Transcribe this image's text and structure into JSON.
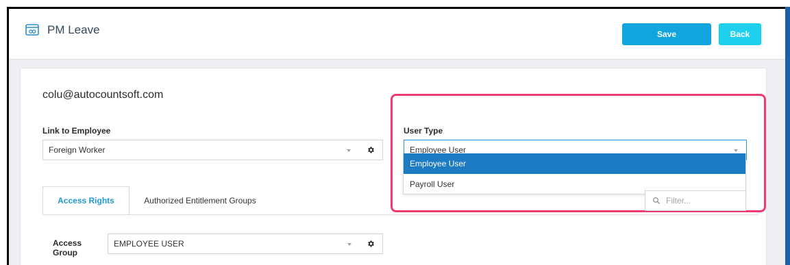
{
  "app": {
    "title": "PM Leave"
  },
  "toolbar": {
    "save_label": "Save",
    "back_label": "Back"
  },
  "account": {
    "email": "colu@autocountsoft.com"
  },
  "link_employee": {
    "label": "Link to Employee",
    "value": "Foreign Worker"
  },
  "user_type": {
    "label": "User Type",
    "value": "Employee User",
    "options": [
      "Employee User",
      "Payroll User"
    ],
    "selected_index": 0
  },
  "tabs": [
    {
      "label": "Access Rights",
      "active": true
    },
    {
      "label": "Authorized Entitlement Groups",
      "active": false
    }
  ],
  "access_group": {
    "label_line1": "Access",
    "label_line2": "Group",
    "value": "EMPLOYEE USER"
  },
  "filter": {
    "placeholder": "Filter..."
  },
  "colors": {
    "save_button": "#12a5dd",
    "back_button": "#1ed0ee",
    "highlight_border": "#ee3a6f",
    "selected_option": "#1d7bc4",
    "active_tab_text": "#1e9ad6"
  }
}
